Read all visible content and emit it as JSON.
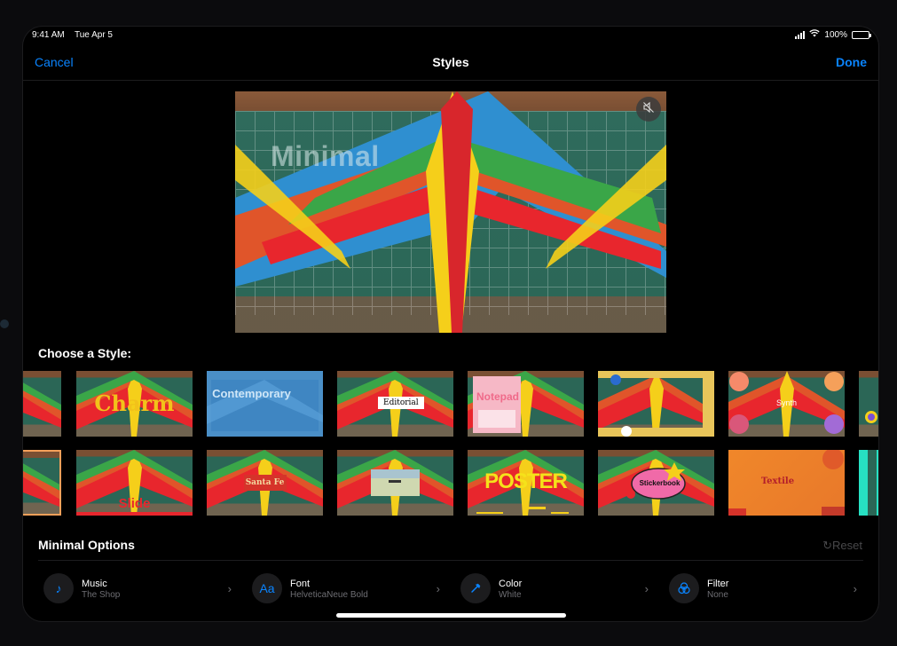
{
  "status": {
    "time": "9:41 AM",
    "date": "Tue Apr 5",
    "battery": "100%"
  },
  "nav": {
    "cancel": "Cancel",
    "title": "Styles",
    "done": "Done"
  },
  "preview": {
    "watermark": "Minimal",
    "mute_icon": "speaker-muted-icon"
  },
  "choose_label": "Choose a Style:",
  "styles_row1": [
    {
      "label": ""
    },
    {
      "label": "Charm"
    },
    {
      "label": "Contemporary"
    },
    {
      "label": "Editorial"
    },
    {
      "label": "Notepad"
    },
    {
      "label": ""
    },
    {
      "label": "Synth"
    },
    {
      "label": ""
    }
  ],
  "styles_row2": [
    {
      "label": ""
    },
    {
      "label": "Slide"
    },
    {
      "label": "Santa Fe"
    },
    {
      "label": ""
    },
    {
      "label": "POSTER"
    },
    {
      "label": "Stickerbook"
    },
    {
      "label": "Textile"
    },
    {
      "label": ""
    }
  ],
  "options": {
    "title": "Minimal Options",
    "reset": "Reset",
    "items": [
      {
        "name": "Music",
        "value": "The Shop",
        "icon": "music-note-icon"
      },
      {
        "name": "Font",
        "value": "HelveticaNeue Bold",
        "icon": "font-icon"
      },
      {
        "name": "Color",
        "value": "White",
        "icon": "eyedropper-icon"
      },
      {
        "name": "Filter",
        "value": "None",
        "icon": "filter-icon"
      }
    ]
  },
  "colors": {
    "accent": "#0a84ff",
    "background": "#000000"
  }
}
